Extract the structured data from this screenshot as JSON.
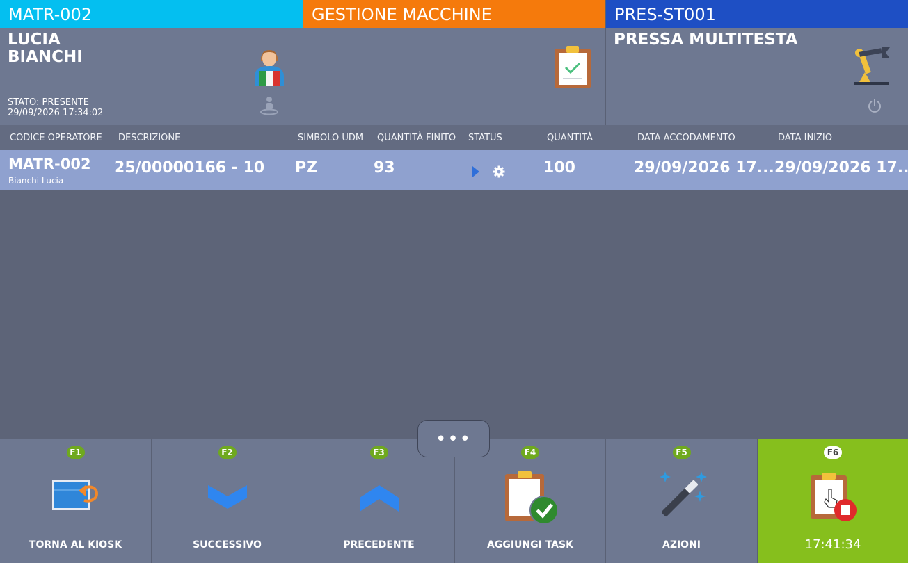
{
  "operator_panel": {
    "code": "MATR-002",
    "name": "LUCIA\nBIANCHI",
    "status_line": "STATO: PRESENTE",
    "datetime": "29/09/2026 17:34:02"
  },
  "app_panel": {
    "title": "GESTIONE MACCHINE"
  },
  "machine_panel": {
    "code": "PRES-ST001",
    "name": "PRESSA MULTITESTA"
  },
  "table": {
    "headers": {
      "operator_code": "CODICE OPERATORE",
      "description": "DESCRIZIONE",
      "uom_symbol": "SIMBOLO UDM",
      "finished_qty": "QUANTITÀ FINITO",
      "status": "STATUS",
      "quantity": "QUANTITÀ",
      "queue_date": "DATA ACCODAMENTO",
      "start_date": "DATA INIZIO"
    },
    "rows": [
      {
        "operator_code": "MATR-002",
        "operator_name": "Bianchi Lucia",
        "description": "25/00000166 - 10",
        "uom_symbol": "PZ",
        "finished_qty": "93",
        "quantity": "100",
        "queue_date": "29/09/2026 17...",
        "start_date": "29/09/2026 17..."
      }
    ]
  },
  "more_button": {
    "label": "•••"
  },
  "function_bar": [
    {
      "key": "F1",
      "label": "TORNA AL KIOSK"
    },
    {
      "key": "F2",
      "label": "SUCCESSIVO"
    },
    {
      "key": "F3",
      "label": "PRECEDENTE"
    },
    {
      "key": "F4",
      "label": "AGGIUNGI TASK"
    },
    {
      "key": "F5",
      "label": "AZIONI"
    },
    {
      "key": "F6",
      "label": "17:41:34"
    }
  ],
  "colors": {
    "operator_header": "#04bff0",
    "app_header": "#f57a0c",
    "machine_header": "#1e4fc4",
    "selected_row": "#8fa1cf",
    "active_key": "#86bf1d"
  },
  "icons": {
    "operator": "operator-avatar-icon",
    "presence": "person-location-icon",
    "app": "clipboard-check-icon",
    "machine": "robot-arm-icon",
    "power": "power-icon",
    "status_play": "play-icon",
    "status_gear": "gear-icon"
  }
}
